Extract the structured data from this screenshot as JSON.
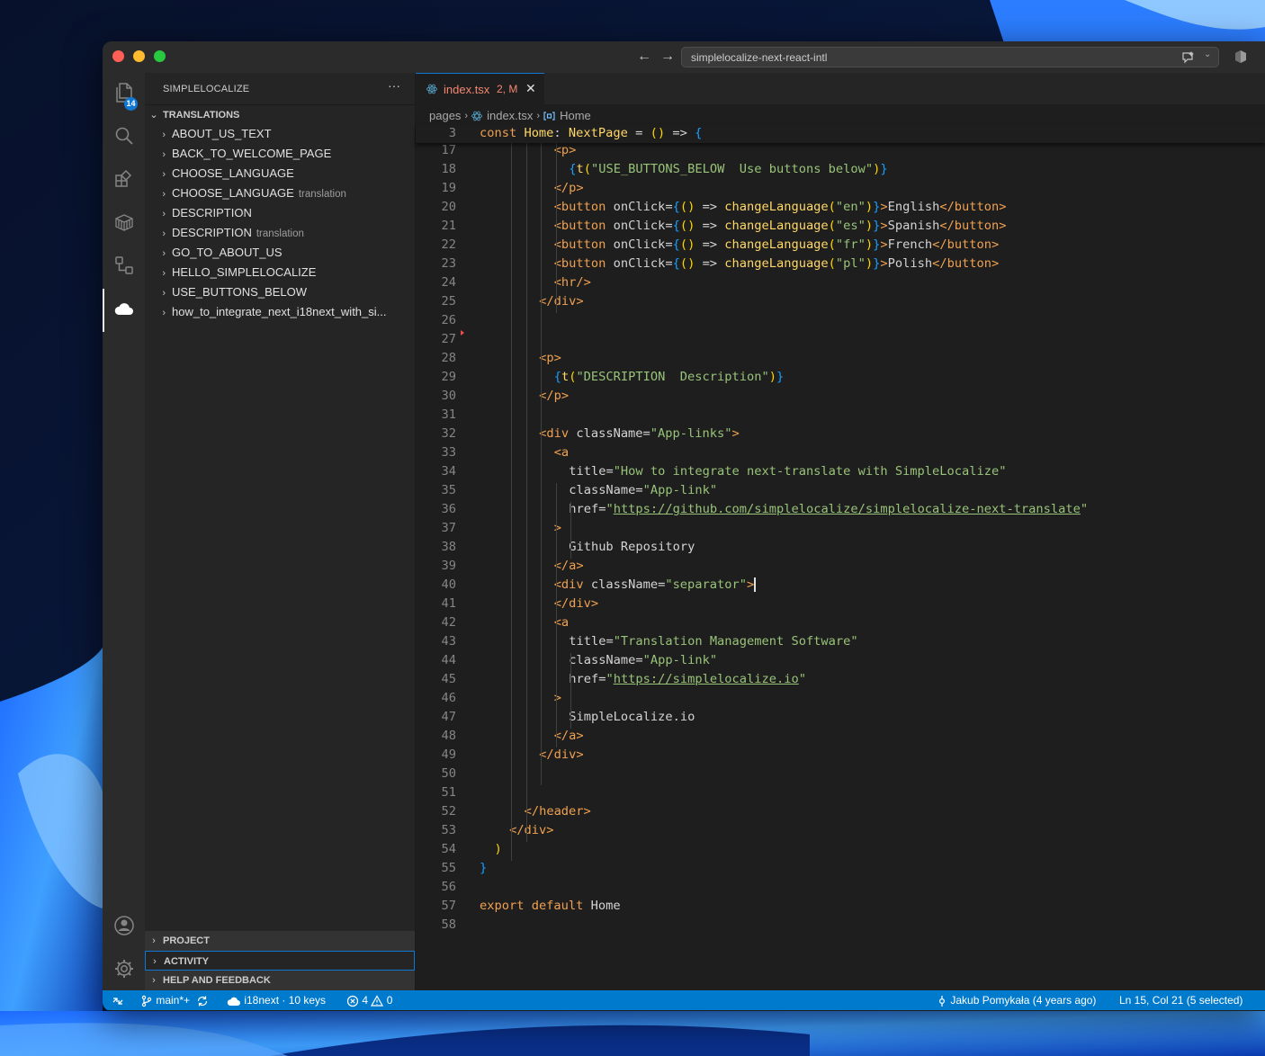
{
  "window": {
    "search_text": "simplelocalize-next-react-intl"
  },
  "activity_bar": {
    "explorer_badge": "14"
  },
  "sidebar": {
    "title": "SIMPLELOCALIZE",
    "more": "···",
    "translations_header": "TRANSLATIONS",
    "items": [
      {
        "label": "ABOUT_US_TEXT",
        "desc": ""
      },
      {
        "label": "BACK_TO_WELCOME_PAGE",
        "desc": ""
      },
      {
        "label": "CHOOSE_LANGUAGE",
        "desc": ""
      },
      {
        "label": "CHOOSE_LANGUAGE",
        "desc": "translation"
      },
      {
        "label": "DESCRIPTION",
        "desc": ""
      },
      {
        "label": "DESCRIPTION",
        "desc": "translation"
      },
      {
        "label": "GO_TO_ABOUT_US",
        "desc": ""
      },
      {
        "label": "HELLO_SIMPLELOCALIZE",
        "desc": ""
      },
      {
        "label": "USE_BUTTONS_BELOW",
        "desc": ""
      },
      {
        "label": "how_to_integrate_next_i18next_with_si...",
        "desc": ""
      }
    ],
    "bottom_sections": [
      "PROJECT",
      "ACTIVITY",
      "HELP AND FEEDBACK"
    ]
  },
  "editor": {
    "tab": {
      "label": "index.tsx",
      "status": "2, M"
    },
    "breadcrumbs": [
      "pages",
      "index.tsx",
      "Home"
    ],
    "sticky": {
      "num": "3",
      "text": "const Home: NextPage = () => {"
    },
    "lines": [
      {
        "n": "17",
        "t": "<p>"
      },
      {
        "n": "18",
        "t": "{t(\"USE_BUTTONS_BELOW  Use buttons below\")}"
      },
      {
        "n": "19",
        "t": "</p>"
      },
      {
        "n": "20",
        "t": "<button onClick={() => changeLanguage(\"en\")}>English</button>"
      },
      {
        "n": "21",
        "t": "<button onClick={() => changeLanguage(\"es\")}>Spanish</button>"
      },
      {
        "n": "22",
        "t": "<button onClick={() => changeLanguage(\"fr\")}>French</button>"
      },
      {
        "n": "23",
        "t": "<button onClick={() => changeLanguage(\"pl\")}>Polish</button>"
      },
      {
        "n": "24",
        "t": "<hr/>"
      },
      {
        "n": "25",
        "t": "</div>"
      },
      {
        "n": "26",
        "t": ""
      },
      {
        "n": "27",
        "t": ""
      },
      {
        "n": "28",
        "t": "<p>"
      },
      {
        "n": "29",
        "t": "{t(\"DESCRIPTION  Description\")}"
      },
      {
        "n": "30",
        "t": "</p>"
      },
      {
        "n": "31",
        "t": ""
      },
      {
        "n": "32",
        "t": "<div className=\"App-links\">"
      },
      {
        "n": "33",
        "t": "<a"
      },
      {
        "n": "34",
        "t": "title=\"How to integrate next-translate with SimpleLocalize\""
      },
      {
        "n": "35",
        "t": "className=\"App-link\""
      },
      {
        "n": "36",
        "t": "href=\"https://github.com/simplelocalize/simplelocalize-next-translate\""
      },
      {
        "n": "37",
        "t": ">"
      },
      {
        "n": "38",
        "t": "Github Repository"
      },
      {
        "n": "39",
        "t": "</a>"
      },
      {
        "n": "40",
        "t": "<div className=\"separator\">"
      },
      {
        "n": "41",
        "t": "</div>"
      },
      {
        "n": "42",
        "t": "<a"
      },
      {
        "n": "43",
        "t": "title=\"Translation Management Software\""
      },
      {
        "n": "44",
        "t": "className=\"App-link\""
      },
      {
        "n": "45",
        "t": "href=\"https://simplelocalize.io\""
      },
      {
        "n": "46",
        "t": ">"
      },
      {
        "n": "47",
        "t": "SimpleLocalize.io"
      },
      {
        "n": "48",
        "t": "</a>"
      },
      {
        "n": "49",
        "t": "</div>"
      },
      {
        "n": "50",
        "t": ""
      },
      {
        "n": "51",
        "t": ""
      },
      {
        "n": "52",
        "t": "</header>"
      },
      {
        "n": "53",
        "t": "</div>"
      },
      {
        "n": "54",
        "t": ")"
      },
      {
        "n": "55",
        "t": "}"
      },
      {
        "n": "56",
        "t": ""
      },
      {
        "n": "57",
        "t": "export default Home"
      },
      {
        "n": "58",
        "t": ""
      }
    ]
  },
  "statusbar": {
    "branch": "main*+",
    "i18n": "i18next · 10 keys",
    "errors": "4",
    "warnings": "0",
    "blame": "Jakub Pomykała (4 years ago)",
    "position": "Ln 15, Col 21 (5 selected)"
  },
  "colors": {
    "status_bar": "#007acc",
    "accent": "#0f78d4",
    "modified_tab": "#f48771"
  }
}
